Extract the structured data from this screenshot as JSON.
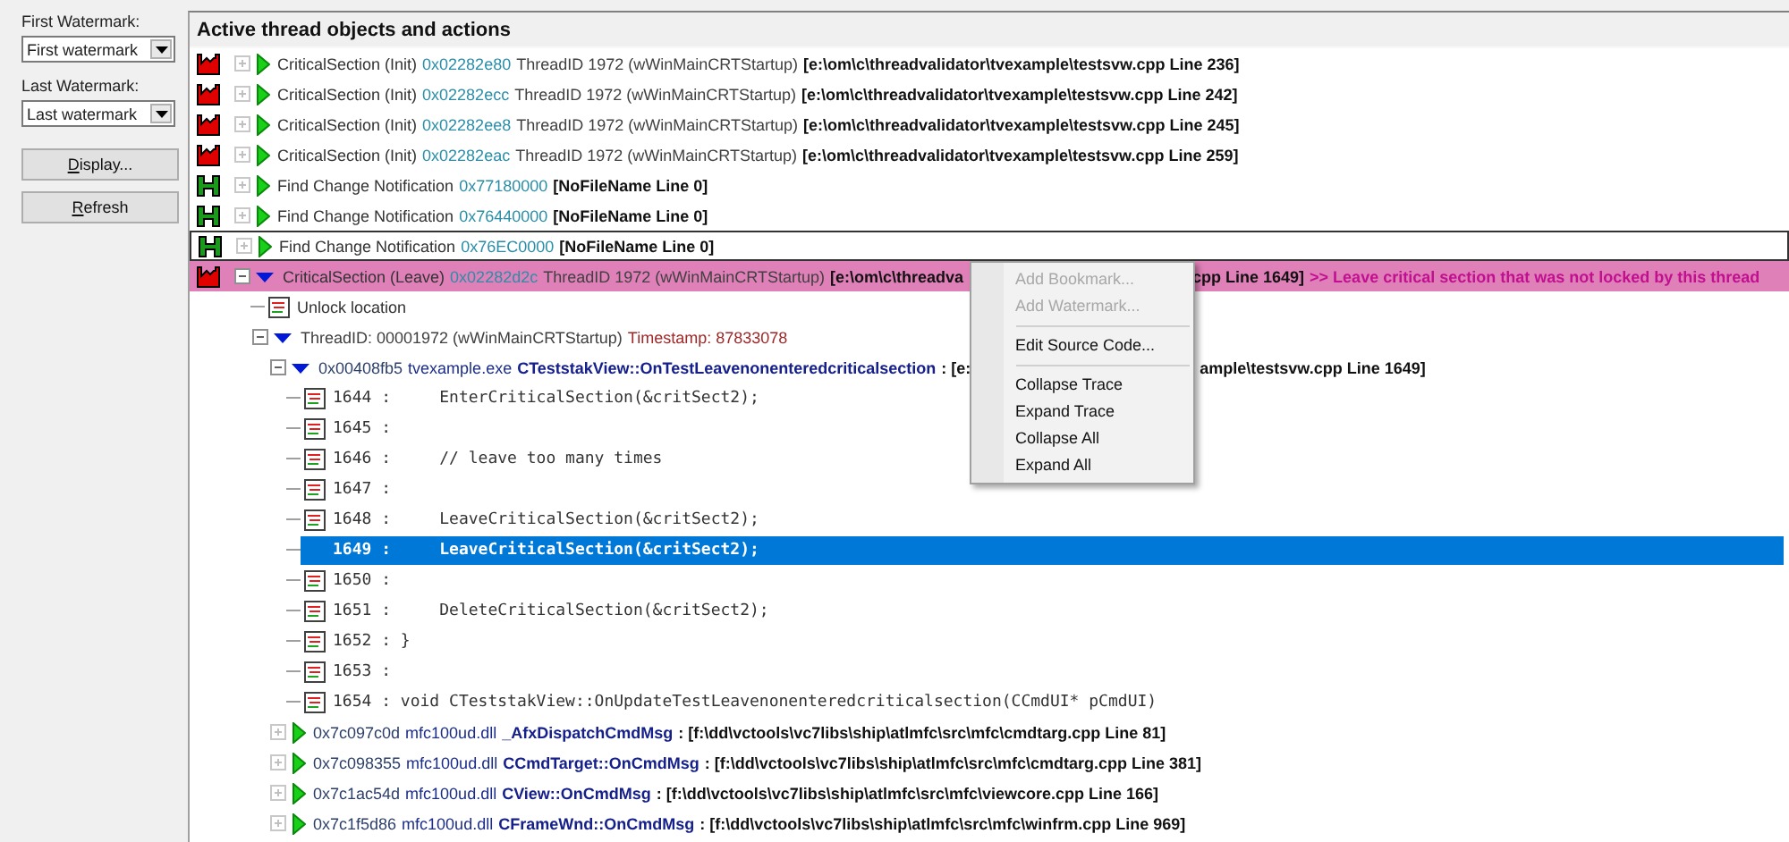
{
  "sidebar": {
    "fields": [
      {
        "label": "First Watermark:",
        "value": "First watermark"
      },
      {
        "label": "Last Watermark:",
        "value": "Last watermark"
      }
    ],
    "buttons": [
      "Display...",
      "Refresh"
    ]
  },
  "tree": {
    "title": "Active thread objects and actions",
    "items": [
      {
        "kind": "critical_section",
        "expanded": false,
        "highlighted": false,
        "focused": false,
        "name": "CriticalSection (Init)",
        "address": "0x02282e80",
        "thread": "ThreadID 1972 (wWinMainCRTStartup)",
        "location": "[e:\\om\\c\\threadvalidator\\tvexample\\testsvw.cpp Line 236]"
      },
      {
        "kind": "critical_section",
        "expanded": false,
        "highlighted": false,
        "focused": false,
        "name": "CriticalSection (Init)",
        "address": "0x02282ecc",
        "thread": "ThreadID 1972 (wWinMainCRTStartup)",
        "location": "[e:\\om\\c\\threadvalidator\\tvexample\\testsvw.cpp Line 242]"
      },
      {
        "kind": "critical_section",
        "expanded": false,
        "highlighted": false,
        "focused": false,
        "name": "CriticalSection (Init)",
        "address": "0x02282ee8",
        "thread": "ThreadID 1972 (wWinMainCRTStartup)",
        "location": "[e:\\om\\c\\threadvalidator\\tvexample\\testsvw.cpp Line 245]"
      },
      {
        "kind": "critical_section",
        "expanded": false,
        "highlighted": false,
        "focused": false,
        "name": "CriticalSection (Init)",
        "address": "0x02282eac",
        "thread": "ThreadID 1972 (wWinMainCRTStartup)",
        "location": "[e:\\om\\c\\threadvalidator\\tvexample\\testsvw.cpp Line 259]"
      },
      {
        "kind": "handle",
        "expanded": false,
        "highlighted": false,
        "focused": false,
        "name": "Find Change Notification",
        "address": "0x77180000",
        "location": "[NoFileName Line 0]"
      },
      {
        "kind": "handle",
        "expanded": false,
        "highlighted": false,
        "focused": false,
        "name": "Find Change Notification",
        "address": "0x76440000",
        "location": "[NoFileName Line 0]"
      },
      {
        "kind": "handle",
        "expanded": false,
        "highlighted": false,
        "focused": true,
        "name": "Find Change Notification",
        "address": "0x76EC0000",
        "location": "[NoFileName Line 0]"
      },
      {
        "kind": "critical_section",
        "expanded": true,
        "highlighted": true,
        "focused": false,
        "name": "CriticalSection (Leave)",
        "address": "0x02282d2c",
        "thread": "ThreadID 1972 (wWinMainCRTStartup)",
        "location": "[e:\\om\\c\\threadva",
        "location_tail": "cpp Line 1649]",
        "message": ">> Leave critical section that was not locked by this thread",
        "children": [
          {
            "kind": "location",
            "label": "Unlock location"
          },
          {
            "kind": "thread",
            "expanded": true,
            "label": "ThreadID: 00001972 (wWinMainCRTStartup)",
            "timestamp": "Timestamp: 87833078",
            "children": [
              {
                "kind": "frame",
                "expanded": true,
                "address": "0x00408fb5",
                "module": "tvexample.exe",
                "function": "CTeststakView::OnTestLeavenonenteredcriticalsection",
                "location": ": [e:",
                "location_tail": "ample\\testsvw.cpp Line 1649]",
                "children": [
                  {
                    "kind": "source",
                    "code": "1644 :     EnterCriticalSection(&critSect2);",
                    "selected": false
                  },
                  {
                    "kind": "source",
                    "code": "1645 :",
                    "selected": false
                  },
                  {
                    "kind": "source",
                    "code": "1646 :     // leave too many times",
                    "selected": false
                  },
                  {
                    "kind": "source",
                    "code": "1647 :",
                    "selected": false
                  },
                  {
                    "kind": "source",
                    "code": "1648 :     LeaveCriticalSection(&critSect2);",
                    "selected": false
                  },
                  {
                    "kind": "source",
                    "code": "1649 :     LeaveCriticalSection(&critSect2);",
                    "selected": true
                  },
                  {
                    "kind": "source",
                    "code": "1650 :",
                    "selected": false
                  },
                  {
                    "kind": "source",
                    "code": "1651 :     DeleteCriticalSection(&critSect2);",
                    "selected": false
                  },
                  {
                    "kind": "source",
                    "code": "1652 : }",
                    "selected": false
                  },
                  {
                    "kind": "source",
                    "code": "1653 :",
                    "selected": false
                  },
                  {
                    "kind": "source",
                    "code": "1654 : void CTeststakView::OnUpdateTestLeavenonenteredcriticalsection(CCmdUI* pCmdUI)",
                    "selected": false
                  }
                ]
              },
              {
                "kind": "frame",
                "expanded": false,
                "address": "0x7c097c0d",
                "module": "mfc100ud.dll",
                "function": "_AfxDispatchCmdMsg",
                "location": ": [f:\\dd\\vctools\\vc7libs\\ship\\atlmfc\\src\\mfc\\cmdtarg.cpp Line 81]"
              },
              {
                "kind": "frame",
                "expanded": false,
                "address": "0x7c098355",
                "module": "mfc100ud.dll",
                "function": "CCmdTarget::OnCmdMsg",
                "location": ": [f:\\dd\\vctools\\vc7libs\\ship\\atlmfc\\src\\mfc\\cmdtarg.cpp Line 381]"
              },
              {
                "kind": "frame",
                "expanded": false,
                "address": "0x7c1ac54d",
                "module": "mfc100ud.dll",
                "function": "CView::OnCmdMsg",
                "location": ": [f:\\dd\\vctools\\vc7libs\\ship\\atlmfc\\src\\mfc\\viewcore.cpp Line 166]"
              },
              {
                "kind": "frame",
                "expanded": false,
                "address": "0x7c1f5d86",
                "module": "mfc100ud.dll",
                "function": "CFrameWnd::OnCmdMsg",
                "location": ": [f:\\dd\\vctools\\vc7libs\\ship\\atlmfc\\src\\mfc\\winfrm.cpp Line 969]"
              }
            ]
          }
        ]
      }
    ]
  },
  "context_menu": {
    "items": [
      {
        "kind": "item",
        "label": "Add Bookmark...",
        "disabled": true
      },
      {
        "kind": "item",
        "label": "Add Watermark...",
        "disabled": true
      },
      {
        "kind": "separator"
      },
      {
        "kind": "item",
        "label": "Edit Source Code...",
        "disabled": false
      },
      {
        "kind": "separator"
      },
      {
        "kind": "item",
        "label": "Collapse Trace",
        "disabled": false
      },
      {
        "kind": "item",
        "label": "Expand Trace",
        "disabled": false
      },
      {
        "kind": "item",
        "label": "Collapse All",
        "disabled": false
      },
      {
        "kind": "item",
        "label": "Expand All",
        "disabled": false
      }
    ]
  }
}
